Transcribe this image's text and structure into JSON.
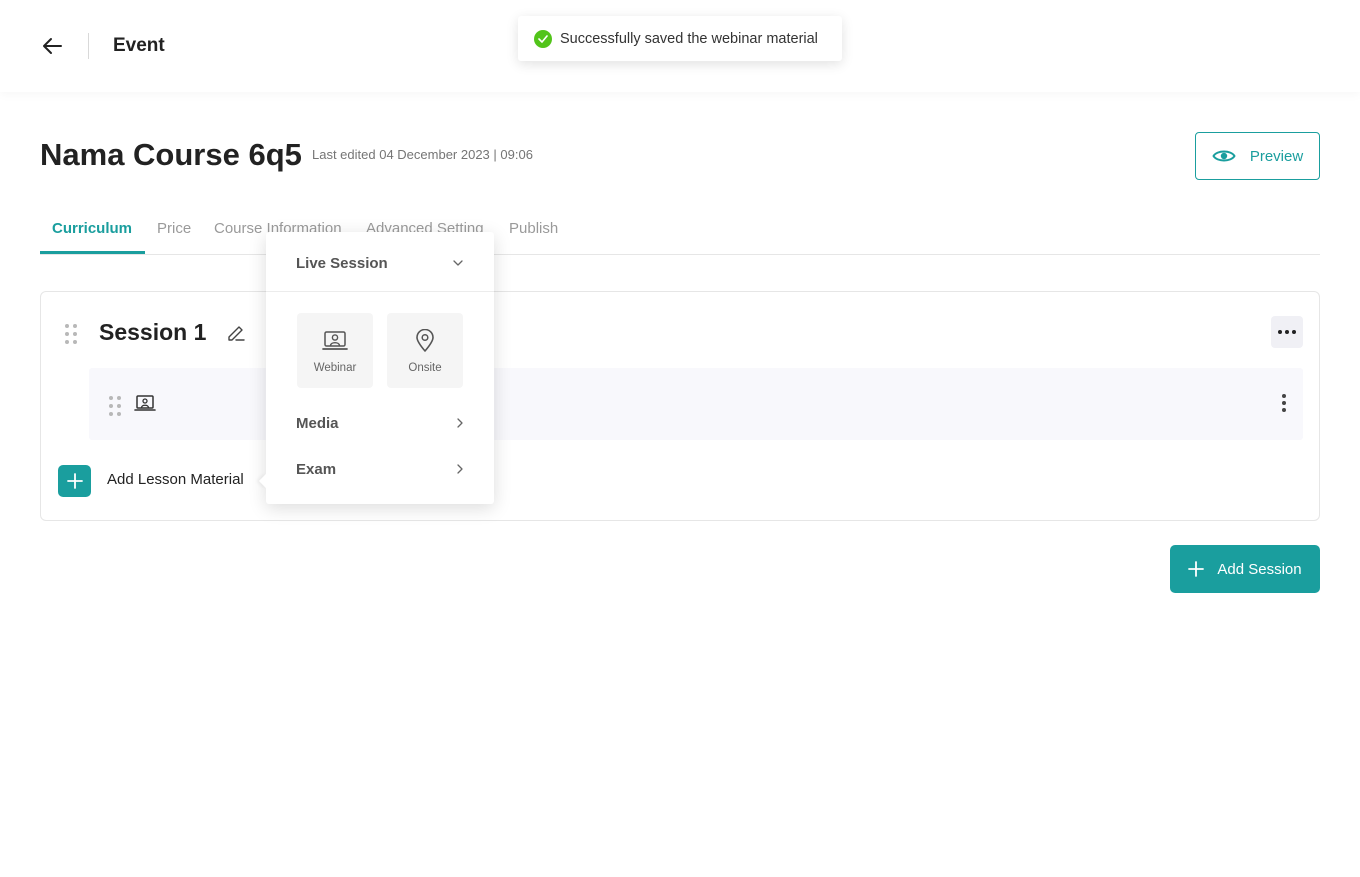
{
  "topbar": {
    "title": "Event"
  },
  "toast": {
    "message": "Successfully saved the webinar material"
  },
  "course": {
    "title": "Nama Course 6q5",
    "last_edited": "Last edited 04 December 2023 | 09:06",
    "preview_label": "Preview"
  },
  "tabs": [
    {
      "label": "Curriculum",
      "active": true
    },
    {
      "label": "Price",
      "active": false
    },
    {
      "label": "Course Information",
      "active": false
    },
    {
      "label": "Advanced Setting",
      "active": false
    },
    {
      "label": "Publish",
      "active": false
    }
  ],
  "session": {
    "title": "Session 1",
    "lesson_icon": "webinar-icon",
    "add_lesson_label": "Add Lesson Material"
  },
  "add_session_label": "Add Session",
  "dropdown": {
    "live_session": {
      "label": "Live Session",
      "icon": "chevron-down-icon"
    },
    "tiles": [
      {
        "label": "Webinar",
        "icon": "webinar-icon"
      },
      {
        "label": "Onsite",
        "icon": "location-pin-icon"
      }
    ],
    "media": {
      "label": "Media",
      "icon": "chevron-right-icon"
    },
    "exam": {
      "label": "Exam",
      "icon": "chevron-right-icon"
    }
  },
  "colors": {
    "accent": "#1a9e9e",
    "success": "#52c41a"
  }
}
